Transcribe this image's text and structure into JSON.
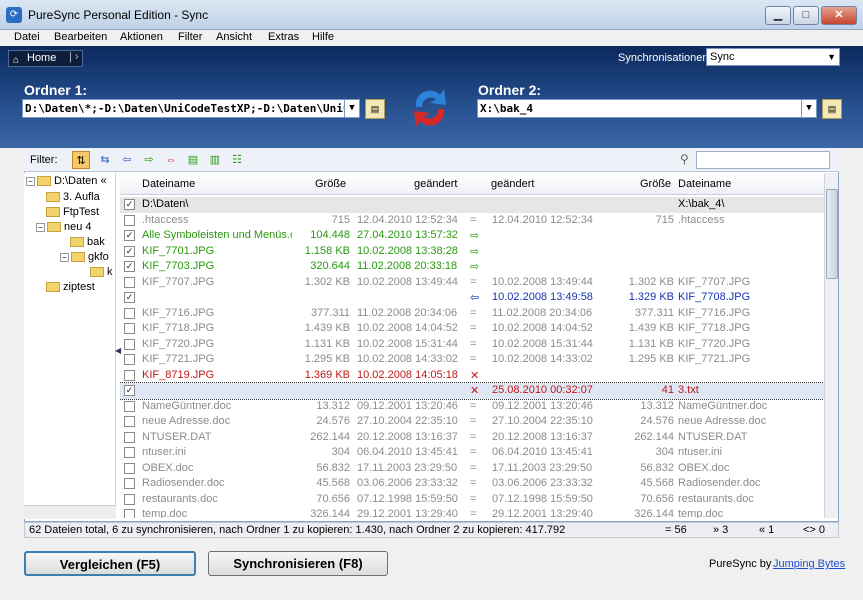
{
  "window": {
    "title": "PureSync Personal Edition  -  Sync",
    "minimize": "▁",
    "maximize": "□",
    "close": "✕"
  },
  "menu": [
    "Datei",
    "Bearbeiten",
    "Aktionen",
    "Filter",
    "Ansicht",
    "Extras",
    "Hilfe"
  ],
  "home": {
    "label": "Home",
    "icon": "home-icon"
  },
  "sync_selector": {
    "label": "Synchronisationen:",
    "value": "Sync"
  },
  "folder1": {
    "label": "Ordner 1:",
    "path": "D:\\Daten\\*;-D:\\Daten\\UniCodeTestXP;-D:\\Daten\\UniCodeTe"
  },
  "folder2": {
    "label": "Ordner 2:",
    "path": "X:\\bak_4"
  },
  "filter": {
    "label": "Filter:"
  },
  "tree": [
    {
      "label": "D:\\Daten «"
    },
    {
      "label": "3. Aufla"
    },
    {
      "label": "FtpTest"
    },
    {
      "label": "neu 4"
    },
    {
      "label": "bak"
    },
    {
      "label": "gkfo"
    },
    {
      "label": "k"
    },
    {
      "label": "ziptest"
    }
  ],
  "columns": {
    "name1": "Dateiname",
    "size1": "Größe",
    "changed1": "geändert",
    "changed2": "geändert",
    "size2": "Größe",
    "name2": "Dateiname"
  },
  "rows": [
    {
      "style": "folderrow",
      "checked": "✓",
      "name1": "D:\\Daten\\",
      "size1": "",
      "date1": "",
      "op": "",
      "date2": "",
      "size2": "",
      "name2": "X:\\bak_4\\"
    },
    {
      "style": "gray",
      "checked": "",
      "name1": ".htaccess",
      "size1": "715",
      "date1": "12.04.2010 12:52:34",
      "op": "=",
      "date2": "12.04.2010 12:52:34",
      "size2": "715",
      "name2": ".htaccess"
    },
    {
      "style": "green",
      "checked": "✓",
      "name1": "Alle Symboleisten und Menüs.c",
      "size1": "104.448",
      "date1": "27.04.2010 13:57:32",
      "op": "⇨",
      "date2": "",
      "size2": "",
      "name2": ""
    },
    {
      "style": "green",
      "checked": "✓",
      "name1": "KIF_7701.JPG",
      "size1": "1.158 KB",
      "date1": "10.02.2008 13:38:28",
      "op": "⇨",
      "date2": "",
      "size2": "",
      "name2": ""
    },
    {
      "style": "green",
      "checked": "✓",
      "name1": "KIF_7703.JPG",
      "size1": "320.644",
      "date1": "11.02.2008 20:33:18",
      "op": "⇨",
      "date2": "",
      "size2": "",
      "name2": ""
    },
    {
      "style": "gray",
      "checked": "",
      "name1": "KIF_7707.JPG",
      "size1": "1.302 KB",
      "date1": "10.02.2008 13:49:44",
      "op": "=",
      "date2": "10.02.2008 13:49:44",
      "size2": "1.302 KB",
      "name2": "KIF_7707.JPG"
    },
    {
      "style": "blue",
      "checked": "✓",
      "name1": "",
      "size1": "",
      "date1": "",
      "op": "⇦",
      "date2": "10.02.2008 13:49:58",
      "size2": "1.329 KB",
      "name2": "KIF_7708.JPG"
    },
    {
      "style": "gray",
      "checked": "",
      "name1": "KIF_7716.JPG",
      "size1": "377.311",
      "date1": "11.02.2008 20:34:06",
      "op": "=",
      "date2": "11.02.2008 20:34:06",
      "size2": "377.311",
      "name2": "KIF_7716.JPG"
    },
    {
      "style": "gray",
      "checked": "",
      "name1": "KIF_7718.JPG",
      "size1": "1.439 KB",
      "date1": "10.02.2008 14:04:52",
      "op": "=",
      "date2": "10.02.2008 14:04:52",
      "size2": "1.439 KB",
      "name2": "KIF_7718.JPG"
    },
    {
      "style": "gray",
      "checked": "",
      "name1": "KIF_7720.JPG",
      "size1": "1.131 KB",
      "date1": "10.02.2008 15:31:44",
      "op": "=",
      "date2": "10.02.2008 15:31:44",
      "size2": "1.131 KB",
      "name2": "KIF_7720.JPG"
    },
    {
      "style": "gray",
      "checked": "",
      "name1": "KIF_7721.JPG",
      "size1": "1.295 KB",
      "date1": "10.02.2008 14:33:02",
      "op": "=",
      "date2": "10.02.2008 14:33:02",
      "size2": "1.295 KB",
      "name2": "KIF_7721.JPG"
    },
    {
      "style": "red",
      "checked": "",
      "name1": "KIF_8719.JPG",
      "size1": "1.369 KB",
      "date1": "10.02.2008 14:05:18",
      "op": "✕",
      "date2": "",
      "size2": "",
      "name2": ""
    },
    {
      "style": "red selected",
      "checked": "✓",
      "name1": "",
      "size1": "",
      "date1": "",
      "op": "✕",
      "date2": "25.08.2010 00:32:07",
      "size2": "41",
      "name2": "3.txt"
    },
    {
      "style": "gray",
      "checked": "",
      "name1": "NameGüntner.doc",
      "size1": "13.312",
      "date1": "09.12.2001 13:20:46",
      "op": "=",
      "date2": "09.12.2001 13:20:46",
      "size2": "13.312",
      "name2": "NameGüntner.doc"
    },
    {
      "style": "gray",
      "checked": "",
      "name1": "neue Adresse.doc",
      "size1": "24.576",
      "date1": "27.10.2004 22:35:10",
      "op": "=",
      "date2": "27.10.2004 22:35:10",
      "size2": "24.576",
      "name2": "neue Adresse.doc"
    },
    {
      "style": "gray",
      "checked": "",
      "name1": "NTUSER.DAT",
      "size1": "262.144",
      "date1": "20.12.2008 13:16:37",
      "op": "=",
      "date2": "20.12.2008 13:16:37",
      "size2": "262.144",
      "name2": "NTUSER.DAT"
    },
    {
      "style": "gray",
      "checked": "",
      "name1": "ntuser.ini",
      "size1": "304",
      "date1": "06.04.2010 13:45:41",
      "op": "=",
      "date2": "06.04.2010 13:45:41",
      "size2": "304",
      "name2": "ntuser.ini"
    },
    {
      "style": "gray",
      "checked": "",
      "name1": "OBEX.doc",
      "size1": "56.832",
      "date1": "17.11.2003 23:29:50",
      "op": "=",
      "date2": "17.11.2003 23:29:50",
      "size2": "56.832",
      "name2": "OBEX.doc"
    },
    {
      "style": "gray",
      "checked": "",
      "name1": "Radiosender.doc",
      "size1": "45.568",
      "date1": "03.06.2006 23:33:32",
      "op": "=",
      "date2": "03.06.2006 23:33:32",
      "size2": "45.568",
      "name2": "Radiosender.doc"
    },
    {
      "style": "gray",
      "checked": "",
      "name1": "restaurants.doc",
      "size1": "70.656",
      "date1": "07.12.1998 15:59:50",
      "op": "=",
      "date2": "07.12.1998 15:59:50",
      "size2": "70.656",
      "name2": "restaurants.doc"
    },
    {
      "style": "gray",
      "checked": "",
      "name1": "temp.doc",
      "size1": "326.144",
      "date1": "29.12.2001 13:29:40",
      "op": "=",
      "date2": "29.12.2001 13:29:40",
      "size2": "326.144",
      "name2": "temp.doc"
    }
  ],
  "status": {
    "summary": "62 Dateien total,  6 zu synchronisieren,  nach Ordner 1 zu kopieren: 1.430,  nach Ordner 2 zu kopieren: 417.792",
    "equal": "= 56",
    "right": "» 3",
    "left": "« 1",
    "diff": "<> 0"
  },
  "buttons": {
    "compare": "Vergleichen (F5)",
    "sync": "Synchronisieren (F8)"
  },
  "brand": {
    "text": "PureSync by",
    "link": "Jumping Bytes"
  },
  "colors": {
    "green": "#2a9a10",
    "blue": "#1535b5",
    "red": "#c01818",
    "gray": "#8c8c8c",
    "header_bg": "#0b2a5e"
  }
}
